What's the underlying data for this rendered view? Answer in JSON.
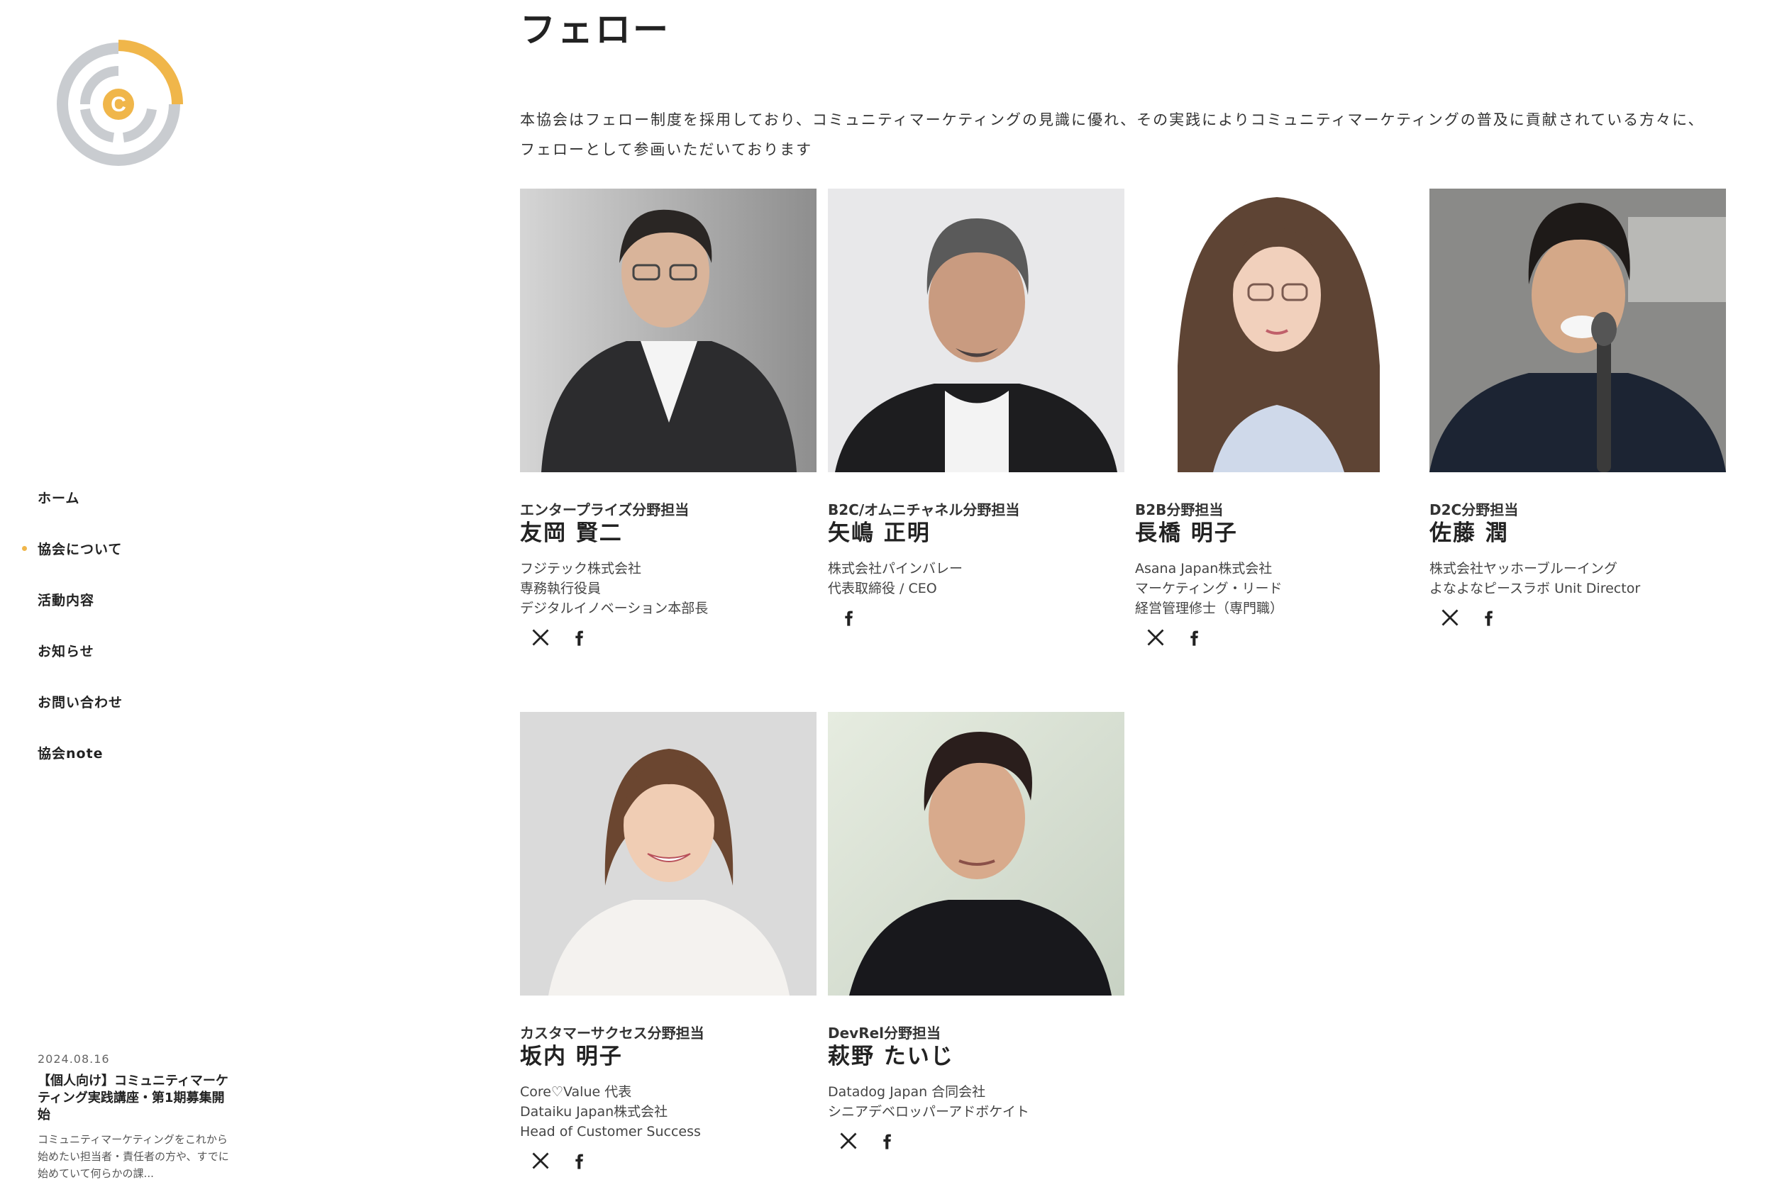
{
  "sidebar": {
    "logo_letter": "C",
    "nav": [
      {
        "label": "ホーム"
      },
      {
        "label": "協会について"
      },
      {
        "label": "活動内容"
      },
      {
        "label": "お知らせ"
      },
      {
        "label": "お問い合わせ"
      },
      {
        "label": "協会note"
      }
    ],
    "active_index": 1,
    "news": {
      "date": "2024.08.16",
      "title": "【個人向け】コミュニティマーケティング実践講座・第1期募集開始",
      "excerpt": "コミュニティマーケティングをこれから始めたい担当者・責任者の方や、すでに始めていて何らかの課..."
    }
  },
  "main": {
    "title": "フェロー",
    "intro_lines": [
      "本協会はフェロー制度を採用しており、コミュニティマーケティングの見識に優れ、その実践によりコミュニティマーケティングの普及に貢献されている方々に、",
      "フェローとして参画いただいております"
    ],
    "fellows": [
      {
        "field": "エンタープライズ分野担当",
        "name": "友岡 賢二",
        "desc": [
          "フジテック株式会社",
          "専務執行役員",
          "デジタルイノベーション本部長"
        ],
        "social": [
          "x-icon",
          "facebook-icon"
        ]
      },
      {
        "field": "B2C/オムニチャネル分野担当",
        "name": "矢嶋 正明",
        "desc": [
          "株式会社パインバレー",
          "代表取締役 / CEO"
        ],
        "social": [
          "facebook-icon"
        ]
      },
      {
        "field": "B2B分野担当",
        "name": "長橋 明子",
        "desc": [
          "Asana Japan株式会社",
          "マーケティング・リード",
          "経営管理修士（専門職）"
        ],
        "social": [
          "x-icon",
          "facebook-icon"
        ]
      },
      {
        "field": "D2C分野担当",
        "name": "佐藤 潤",
        "desc": [
          "株式会社ヤッホーブルーイング",
          "よなよなピースラボ Unit Director"
        ],
        "social": [
          "x-icon",
          "facebook-icon"
        ]
      },
      {
        "field": "カスタマーサクセス分野担当",
        "name": "坂内 明子",
        "desc": [
          "Core♡Value 代表",
          "Dataiku Japan株式会社",
          "Head of Customer Success"
        ],
        "social": [
          "x-icon",
          "facebook-icon"
        ]
      },
      {
        "field": "DevRel分野担当",
        "name": "萩野 たいじ",
        "desc": [
          "Datadog Japan 合同会社",
          "シニアデベロッパーアドボケイト"
        ],
        "social": [
          "x-icon",
          "facebook-icon"
        ]
      }
    ]
  },
  "colors": {
    "accent": "#f0b64a",
    "logo_gray": "#c9ccd0",
    "text": "#222222"
  }
}
